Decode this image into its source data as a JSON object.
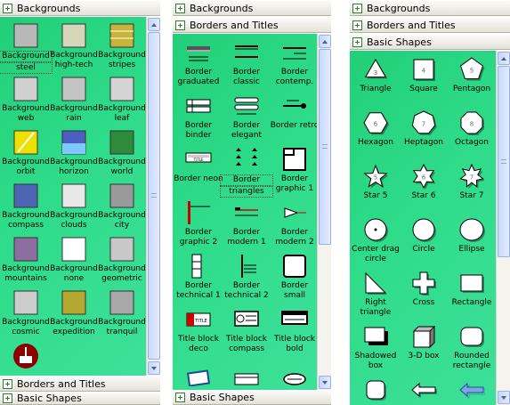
{
  "panels": [
    {
      "sections": [
        "Backgrounds",
        "Borders and Titles",
        "Basic Shapes"
      ],
      "items": [
        {
          "l1": "Background",
          "l2": "steel",
          "icon": "steel-background-icon",
          "c": "#b8b8b8",
          "sel": true
        },
        {
          "l1": "Background",
          "l2": "high-tech",
          "icon": "high-tech-background-icon",
          "c": "#d6d6b8"
        },
        {
          "l1": "Background",
          "l2": "stripes",
          "icon": "stripes-background-icon",
          "c": "#c8b43a"
        },
        {
          "l1": "Background",
          "l2": "web",
          "icon": "web-background-icon",
          "c": "#d0d0d0"
        },
        {
          "l1": "Background",
          "l2": "rain",
          "icon": "rain-background-icon",
          "c": "#c4c4c4"
        },
        {
          "l1": "Background",
          "l2": "leaf",
          "icon": "leaf-background-icon",
          "c": "#d4d4d4"
        },
        {
          "l1": "Background",
          "l2": "orbit",
          "icon": "orbit-background-icon",
          "c": "#f0e000"
        },
        {
          "l1": "Background",
          "l2": "horizon",
          "icon": "horizon-background-icon",
          "c": "#4b5fc0"
        },
        {
          "l1": "Background",
          "l2": "world",
          "icon": "world-background-icon",
          "c": "#2f8a3c"
        },
        {
          "l1": "Background",
          "l2": "compass",
          "icon": "compass-background-icon",
          "c": "#5064b4"
        },
        {
          "l1": "Background",
          "l2": "clouds",
          "icon": "clouds-background-icon",
          "c": "#e8e8e8"
        },
        {
          "l1": "Background",
          "l2": "city",
          "icon": "city-background-icon",
          "c": "#9a9a9a"
        },
        {
          "l1": "Background",
          "l2": "mountains",
          "icon": "mountains-background-icon",
          "c": "#8c6fa0"
        },
        {
          "l1": "Background",
          "l2": "none",
          "icon": "none-background-icon",
          "c": "#ffffff"
        },
        {
          "l1": "Background",
          "l2": "geometric",
          "icon": "geometric-background-icon",
          "c": "#c8c8c8"
        },
        {
          "l1": "Background",
          "l2": "cosmic",
          "icon": "cosmic-background-icon",
          "c": "#cccccc"
        },
        {
          "l1": "Background",
          "l2": "expedition",
          "icon": "expedition-background-icon",
          "c": "#b5a830"
        },
        {
          "l1": "Background",
          "l2": "tranquil",
          "icon": "tranquil-background-icon",
          "c": "#a8a8a8"
        },
        {
          "l1": "",
          "l2": "",
          "icon": "logo-background-icon",
          "c": "#8b0000"
        }
      ]
    },
    {
      "sections": [
        "Backgrounds",
        "Borders and Titles",
        "Basic Shapes"
      ],
      "items": [
        {
          "l1": "Border",
          "l2": "graduated",
          "icon": "border-graduated-icon"
        },
        {
          "l1": "Border",
          "l2": "classic",
          "icon": "border-classic-icon"
        },
        {
          "l1": "Border",
          "l2": "contemp.",
          "icon": "border-contemporary-icon"
        },
        {
          "l1": "Border",
          "l2": "binder",
          "icon": "border-binder-icon"
        },
        {
          "l1": "Border",
          "l2": "elegant",
          "icon": "border-elegant-icon"
        },
        {
          "l1": "Border retro",
          "l2": "",
          "icon": "border-retro-icon"
        },
        {
          "l1": "Border neon",
          "l2": "",
          "icon": "border-neon-icon"
        },
        {
          "l1": "Border",
          "l2": "triangles",
          "icon": "border-triangles-icon",
          "sel": true
        },
        {
          "l1": "Border",
          "l2": "graphic 1",
          "icon": "border-graphic-1-icon"
        },
        {
          "l1": "Border",
          "l2": "graphic 2",
          "icon": "border-graphic-2-icon"
        },
        {
          "l1": "Border",
          "l2": "modern 1",
          "icon": "border-modern-1-icon"
        },
        {
          "l1": "Border",
          "l2": "modern 2",
          "icon": "border-modern-2-icon"
        },
        {
          "l1": "Border",
          "l2": "technical 1",
          "icon": "border-technical-1-icon"
        },
        {
          "l1": "Border",
          "l2": "technical 2",
          "icon": "border-technical-2-icon"
        },
        {
          "l1": "Border",
          "l2": "small",
          "icon": "border-small-icon"
        },
        {
          "l1": "Title block",
          "l2": "deco",
          "icon": "title-block-deco-icon"
        },
        {
          "l1": "Title block",
          "l2": "compass",
          "icon": "title-block-compass-icon"
        },
        {
          "l1": "Title block",
          "l2": "bold",
          "icon": "title-block-bold-icon"
        },
        {
          "l1": "",
          "l2": "",
          "icon": "title-block-partial-1-icon"
        },
        {
          "l1": "",
          "l2": "",
          "icon": "title-block-partial-2-icon"
        },
        {
          "l1": "",
          "l2": "",
          "icon": "title-block-partial-3-icon"
        }
      ]
    },
    {
      "sections": [
        "Backgrounds",
        "Borders and Titles",
        "Basic Shapes"
      ],
      "items": [
        {
          "l1": "Triangle",
          "l2": "",
          "icon": "triangle-icon",
          "n": "3"
        },
        {
          "l1": "Square",
          "l2": "",
          "icon": "square-icon",
          "n": "4"
        },
        {
          "l1": "Pentagon",
          "l2": "",
          "icon": "pentagon-icon",
          "n": "5"
        },
        {
          "l1": "Hexagon",
          "l2": "",
          "icon": "hexagon-icon",
          "n": "6"
        },
        {
          "l1": "Heptagon",
          "l2": "",
          "icon": "heptagon-icon",
          "n": "7"
        },
        {
          "l1": "Octagon",
          "l2": "",
          "icon": "octagon-icon",
          "n": "8"
        },
        {
          "l1": "Star 5",
          "l2": "",
          "icon": "star-5-icon",
          "n": "5"
        },
        {
          "l1": "Star 6",
          "l2": "",
          "icon": "star-6-icon",
          "n": "6"
        },
        {
          "l1": "Star 7",
          "l2": "",
          "icon": "star-7-icon",
          "n": "7"
        },
        {
          "l1": "Center drag",
          "l2": "circle",
          "icon": "center-drag-circle-icon"
        },
        {
          "l1": "Circle",
          "l2": "",
          "icon": "circle-icon"
        },
        {
          "l1": "Ellipse",
          "l2": "",
          "icon": "ellipse-icon"
        },
        {
          "l1": "Right",
          "l2": "triangle",
          "icon": "right-triangle-icon"
        },
        {
          "l1": "Cross",
          "l2": "",
          "icon": "cross-icon"
        },
        {
          "l1": "Rectangle",
          "l2": "",
          "icon": "rectangle-icon"
        },
        {
          "l1": "Shadowed",
          "l2": "box",
          "icon": "shadowed-box-icon"
        },
        {
          "l1": "3-D box",
          "l2": "",
          "icon": "3d-box-icon"
        },
        {
          "l1": "Rounded",
          "l2": "rectangle",
          "icon": "rounded-rectangle-icon"
        },
        {
          "l1": "",
          "l2": "",
          "icon": "rounded-square-icon"
        },
        {
          "l1": "",
          "l2": "",
          "icon": "left-arrow-icon"
        },
        {
          "l1": "",
          "l2": "",
          "icon": "blue-arrow-icon"
        }
      ]
    }
  ]
}
